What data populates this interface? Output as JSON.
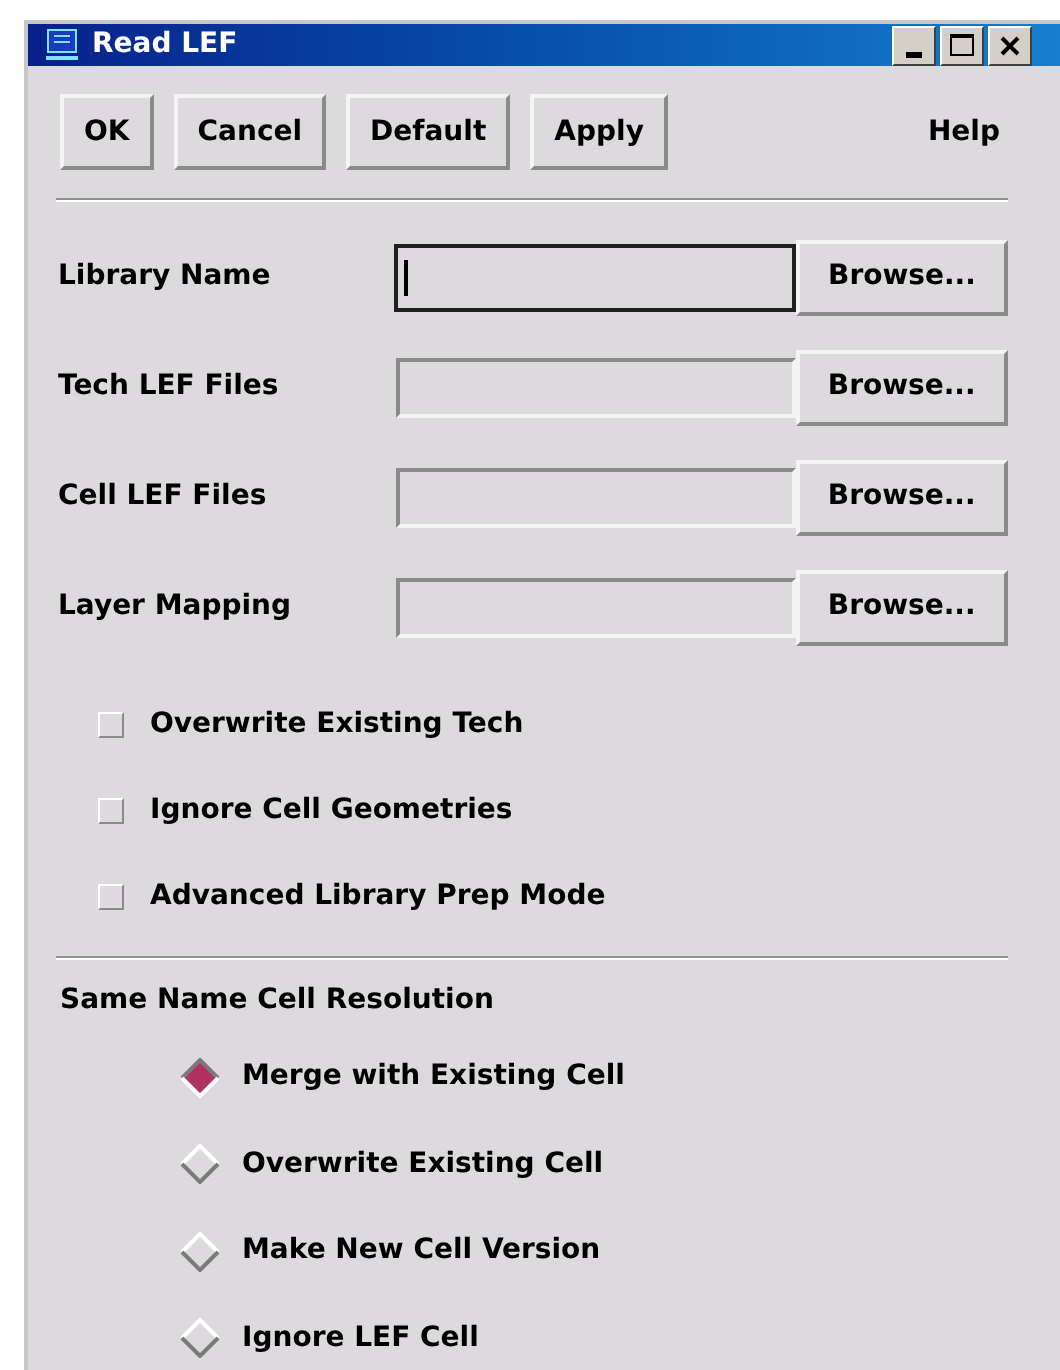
{
  "window": {
    "title": "Read LEF"
  },
  "buttons": [
    "OK",
    "Cancel",
    "Default",
    "Apply"
  ],
  "help": "Help",
  "fields": [
    {
      "label": "Library Name",
      "focused": true,
      "button": "Browse..."
    },
    {
      "label": "Tech LEF Files",
      "focused": false,
      "button": "Browse..."
    },
    {
      "label": "Cell LEF Files",
      "focused": false,
      "button": "Browse..."
    },
    {
      "label": "Layer Mapping",
      "focused": false,
      "button": "Browse..."
    }
  ],
  "options": [
    {
      "label": "Overwrite Existing Tech",
      "checked": false
    },
    {
      "label": "Ignore Cell Geometries",
      "checked": false
    },
    {
      "label": "Advanced Library Prep Mode",
      "checked": false
    }
  ],
  "resolution": {
    "title": "Same Name Cell Resolution",
    "choices": [
      {
        "label": "Merge with Existing Cell",
        "selected": true
      },
      {
        "label": "Overwrite Existing Cell",
        "selected": false
      },
      {
        "label": "Make New Cell Version",
        "selected": false
      },
      {
        "label": "Ignore LEF Cell",
        "selected": false
      }
    ]
  }
}
